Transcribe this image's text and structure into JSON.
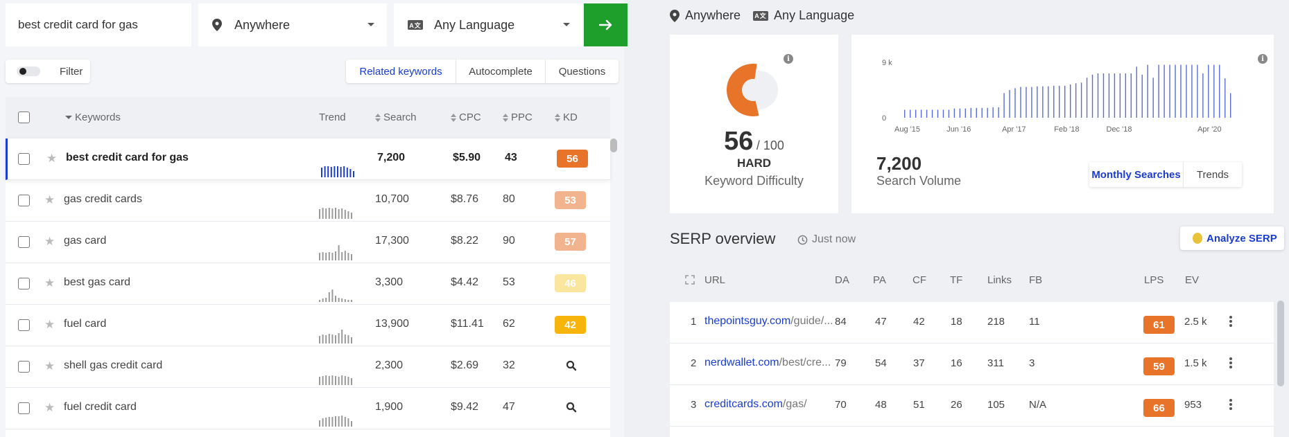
{
  "search": {
    "query": "best credit card for gas",
    "location": "Anywhere",
    "language": "Any Language"
  },
  "filter": {
    "label": "Filter"
  },
  "tabs": [
    "Related keywords",
    "Autocomplete",
    "Questions"
  ],
  "table": {
    "headers": {
      "keywords": "Keywords",
      "trend": "Trend",
      "search": "Search",
      "cpc": "CPC",
      "ppc": "PPC",
      "kd": "KD"
    },
    "rows": [
      {
        "keyword": "best credit card for gas",
        "search": "7,200",
        "cpc": "$5.90",
        "ppc": "43",
        "kd": "56",
        "kd_color": "#e8742a",
        "selected": true
      },
      {
        "keyword": "gas credit cards",
        "search": "10,700",
        "cpc": "$8.76",
        "ppc": "80",
        "kd": "53",
        "kd_color": "#f2b48f"
      },
      {
        "keyword": "gas card",
        "search": "17,300",
        "cpc": "$8.22",
        "ppc": "90",
        "kd": "57",
        "kd_color": "#f2b48f"
      },
      {
        "keyword": "best gas card",
        "search": "3,300",
        "cpc": "$4.42",
        "ppc": "53",
        "kd": "46",
        "kd_color": "#fbe6a0"
      },
      {
        "keyword": "fuel card",
        "search": "13,900",
        "cpc": "$11.41",
        "ppc": "62",
        "kd": "42",
        "kd_color": "#f7b40a"
      },
      {
        "keyword": "shell gas credit card",
        "search": "2,300",
        "cpc": "$2.69",
        "ppc": "32",
        "kd": ""
      },
      {
        "keyword": "fuel credit card",
        "search": "1,900",
        "cpc": "$9.42",
        "ppc": "47",
        "kd": ""
      }
    ]
  },
  "overview": {
    "location": "Anywhere",
    "language": "Any Language",
    "kd_value": "56",
    "kd_max": "/ 100",
    "kd_level": "HARD",
    "kd_label": "Keyword Difficulty",
    "kd_fraction": 0.56,
    "volume": "7,200",
    "volume_label": "Search Volume",
    "volume_tabs": [
      "Monthly Searches",
      "Trends"
    ]
  },
  "chart_data": {
    "type": "bar",
    "y_ticks": [
      "9 k",
      "0"
    ],
    "x_ticks": [
      "Aug '15",
      "Jun '16",
      "Apr '17",
      "Feb '18",
      "Dec '18",
      "Apr '20"
    ],
    "values": [
      1.3,
      1.3,
      1.3,
      1.3,
      1.3,
      1.3,
      1.3,
      1.3,
      1.3,
      1.5,
      1.5,
      1.5,
      1.6,
      1.6,
      1.6,
      1.6,
      1.7,
      1.7,
      4.0,
      4.5,
      4.8,
      5.0,
      5.0,
      5.0,
      5.1,
      5.1,
      5.1,
      5.2,
      5.2,
      5.2,
      5.4,
      5.6,
      5.7,
      6.5,
      7.0,
      7.2,
      7.2,
      7.2,
      7.2,
      7.2,
      7.2,
      7.2,
      8.3,
      7.0,
      8.6,
      6.5,
      8.6,
      8.6,
      8.6,
      8.6,
      8.6,
      8.6,
      8.6,
      8.6,
      7.2,
      8.6,
      8.6,
      8.6,
      6.4,
      4.0
    ],
    "ylim": [
      0,
      9
    ]
  },
  "serp": {
    "title": "SERP overview",
    "time": "Just now",
    "analyze_label": "Analyze SERP",
    "headers": [
      "URL",
      "DA",
      "PA",
      "CF",
      "TF",
      "Links",
      "FB",
      "LPS",
      "EV"
    ],
    "rows": [
      {
        "rank": "1",
        "domain": "thepointsguy.com",
        "path": "/guide/...",
        "da": "84",
        "pa": "47",
        "cf": "42",
        "tf": "18",
        "links": "218",
        "fb": "11",
        "lps": "61",
        "ev": "2.5 k"
      },
      {
        "rank": "2",
        "domain": "nerdwallet.com",
        "path": "/best/cre...",
        "da": "79",
        "pa": "54",
        "cf": "37",
        "tf": "16",
        "links": "311",
        "fb": "3",
        "lps": "59",
        "ev": "1.5 k"
      },
      {
        "rank": "3",
        "domain": "creditcards.com",
        "path": "/gas/",
        "da": "70",
        "pa": "48",
        "cf": "51",
        "tf": "26",
        "links": "105",
        "fb": "N/A",
        "lps": "66",
        "ev": "953"
      }
    ]
  },
  "colors": {
    "accent": "#1a3ccf",
    "go": "#1e9e2b",
    "kd_orange": "#e8742a"
  }
}
